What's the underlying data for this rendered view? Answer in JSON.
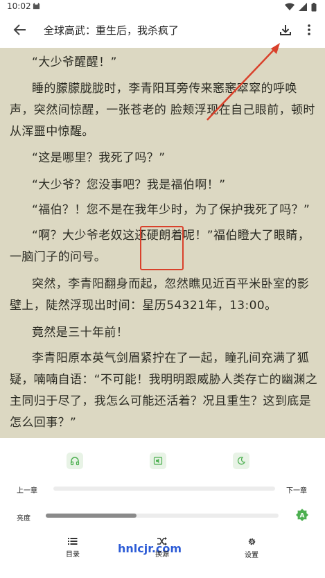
{
  "status": {
    "time": "10:02"
  },
  "header": {
    "title": "全球高武：重生后，我杀疯了"
  },
  "chapter": {
    "paragraphs": [
      "“大少爷醒醒！”",
      "睡的朦朦胧胧时，李青阳耳旁传来窸窸窣窣的呼唤声，突然间惊醒，一张苍老的 脸颊浮现在自己眼前，顿时从浑噩中惊醒。",
      "“这是哪里？我死了吗？”",
      "“大少爷？您没事吧？我是福伯啊！”",
      "“福伯？！您不是在我年少时，为了保护我死了吗？”",
      "“啊？大少爷老奴这还硬朗着呢！”福伯瞪大了眼睛，一脑门子的问号。",
      "突然，李青阳翻身而起，忽然瞧见近百平米卧室的影壁上，陡然浮现出时间：星历54321年，13:00。",
      "竟然是三十年前！",
      "李青阳原本英气剑眉紧拧在了一起，瞳孔间充满了狐疑，喃喃自语：“不可能！我明明跟威胁人类存亡的幽渊之主同归于尽了，我怎么可能还活着？况且重生？这到底是怎么回事？”"
    ]
  },
  "watermark": "hnlcjr.com",
  "controls": {
    "prev_chapter": "上一章",
    "next_chapter": "下一章",
    "brightness_label": "亮度",
    "chapter_progress": 0,
    "brightness": 0.39,
    "auto_badge": "A"
  },
  "bottom_nav": [
    {
      "label": "目录",
      "icon": "menu-list-icon"
    },
    {
      "label": "换源",
      "icon": "shuffle-icon"
    },
    {
      "label": "设置",
      "icon": "gear-icon"
    }
  ],
  "colors": {
    "reader_bg": "#dcd8c2",
    "accent": "#4caf50",
    "annotation": "#d9412b"
  }
}
